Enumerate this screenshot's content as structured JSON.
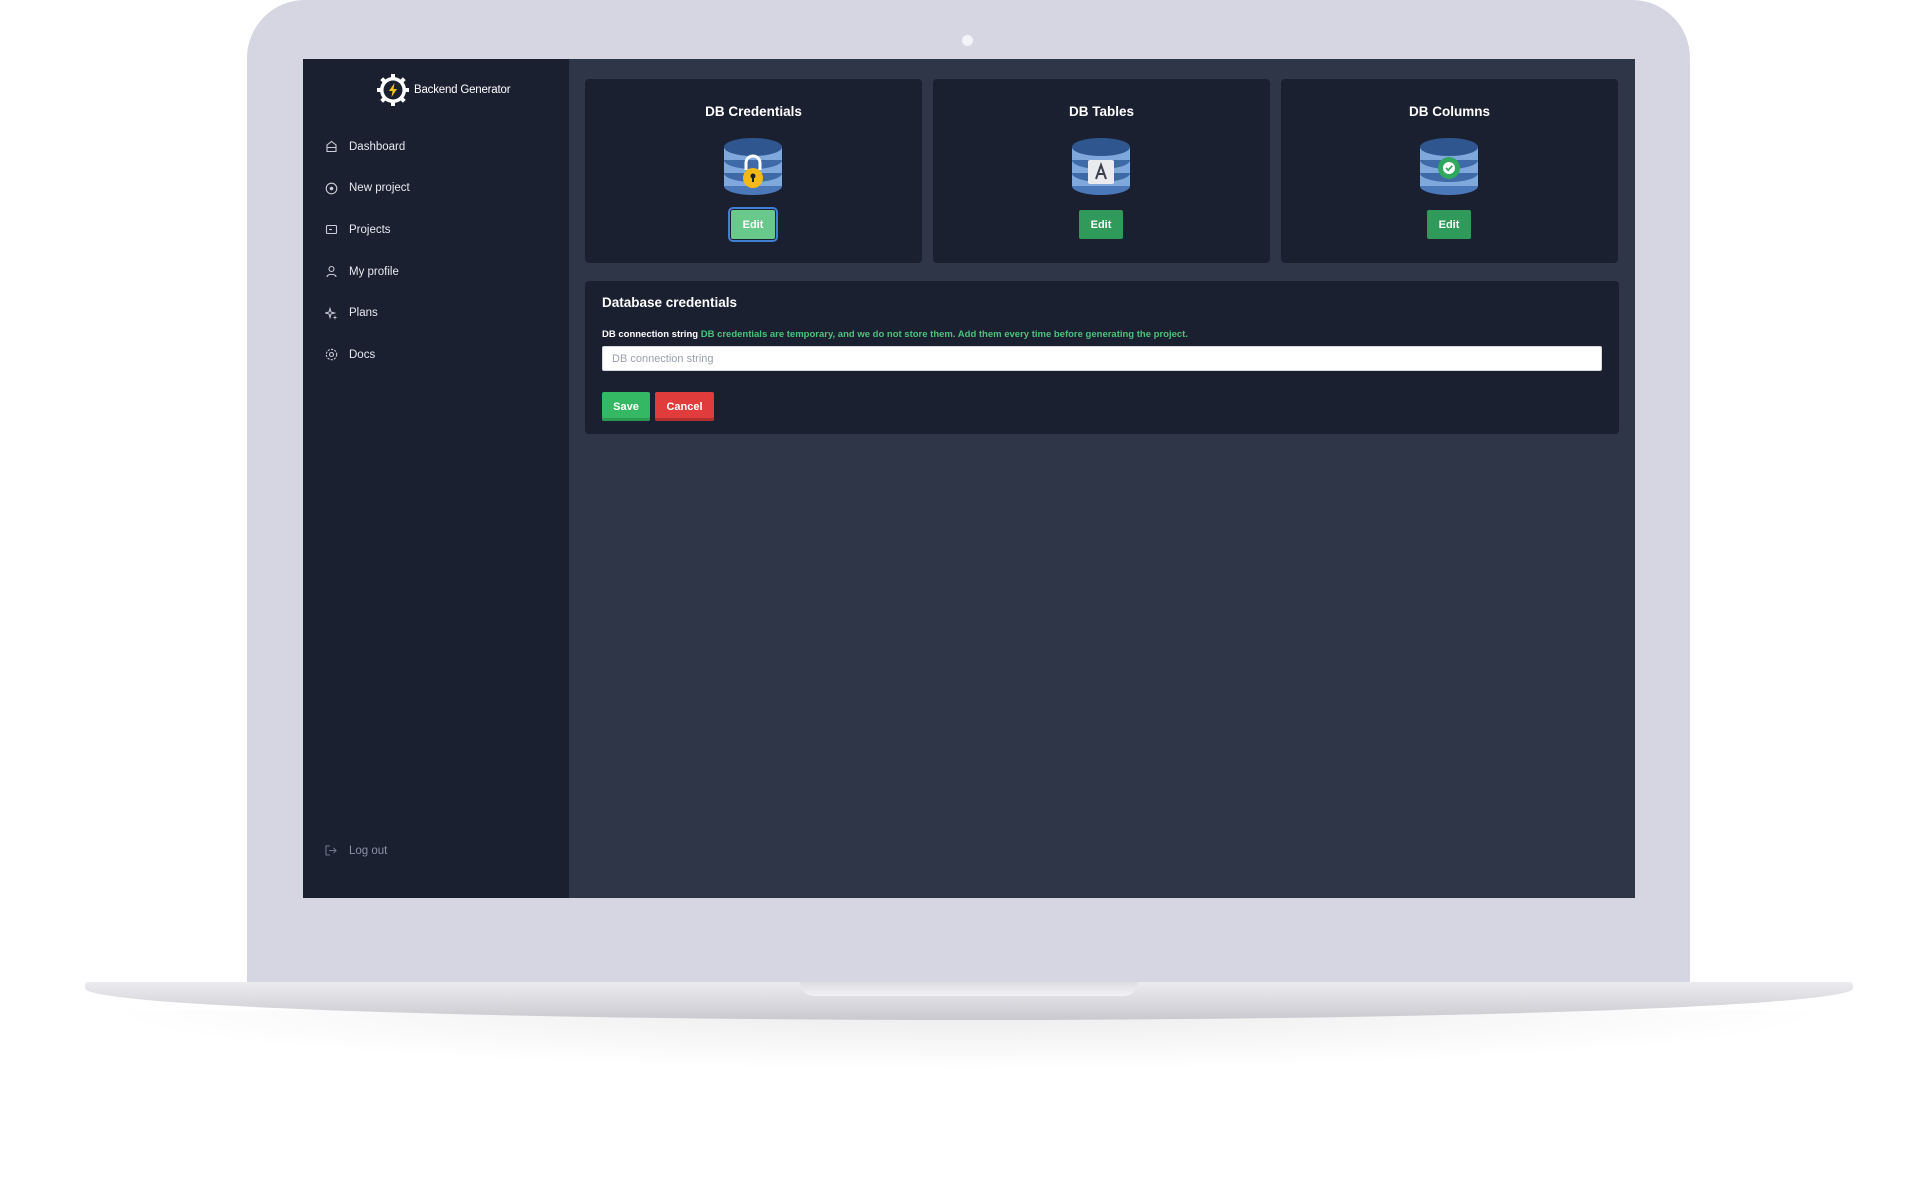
{
  "app": {
    "name": "Backend Generator"
  },
  "sidebar": {
    "items": [
      {
        "label": "Dashboard",
        "icon": "dashboard-icon"
      },
      {
        "label": "New project",
        "icon": "plus-circle-icon"
      },
      {
        "label": "Projects",
        "icon": "folder-icon"
      },
      {
        "label": "My profile",
        "icon": "user-icon"
      },
      {
        "label": "Plans",
        "icon": "sparkle-icon"
      },
      {
        "label": "Docs",
        "icon": "settings-icon"
      }
    ],
    "logout_label": "Log out"
  },
  "cards": [
    {
      "title": "DB Credentials",
      "edit_label": "Edit",
      "icon": "database-lock-icon",
      "active": true
    },
    {
      "title": "DB Tables",
      "edit_label": "Edit",
      "icon": "database-table-icon",
      "active": false
    },
    {
      "title": "DB Columns",
      "edit_label": "Edit",
      "icon": "database-check-icon",
      "active": false
    }
  ],
  "form": {
    "title": "Database credentials",
    "label": "DB connection string",
    "hint": "DB credentials are temporary, and we do not store them. Add them every time before generating the project.",
    "placeholder": "DB connection string",
    "value": "",
    "save_label": "Save",
    "cancel_label": "Cancel"
  },
  "colors": {
    "sidebar_bg": "#1b2030",
    "main_bg": "#2e3648",
    "accent_green": "#2f9a5a",
    "cancel_red": "#e03c3c",
    "hint_green": "#49c27a"
  }
}
